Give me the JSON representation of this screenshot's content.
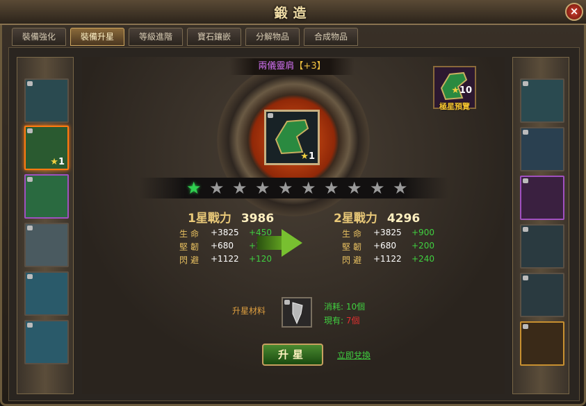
{
  "window": {
    "title": "鍛造",
    "close_label": "×"
  },
  "tabs": [
    {
      "label": "裝備強化",
      "active": false
    },
    {
      "label": "裝備升星",
      "active": true
    },
    {
      "label": "等級進階",
      "active": false
    },
    {
      "label": "寶石鑲嵌",
      "active": false
    },
    {
      "label": "分解物品",
      "active": false
    },
    {
      "label": "合成物品",
      "active": false
    }
  ],
  "left_slots": [
    {
      "name": "hood",
      "color": "#2a4a50"
    },
    {
      "name": "shoulder",
      "color": "#2a5a30",
      "stars": "1",
      "selected": true
    },
    {
      "name": "armor",
      "color": "#2a6a40"
    },
    {
      "name": "belt",
      "color": "#4a5a60"
    },
    {
      "name": "pants",
      "color": "#2a5a6a"
    },
    {
      "name": "boots",
      "color": "#2a5a6a"
    }
  ],
  "right_slots": [
    {
      "name": "bracer",
      "color": "#2a4a50"
    },
    {
      "name": "glove",
      "color": "#2a4050"
    },
    {
      "name": "amulet",
      "color": "#3a2040"
    },
    {
      "name": "ring",
      "color": "#2a3a40"
    },
    {
      "name": "necklace",
      "color": "#2a3a40"
    },
    {
      "name": "weapon",
      "color": "#3a2a18"
    }
  ],
  "item": {
    "name": "兩儀靈肩",
    "plus": "【+3】",
    "stars": "1"
  },
  "preview": {
    "stars": "10",
    "label": "極星預覽"
  },
  "star_rating": {
    "current": 1,
    "max": 10
  },
  "current": {
    "title": "1星戰力",
    "power": "3986",
    "stats": [
      {
        "key": "生命",
        "base": "+3825",
        "add": "+450"
      },
      {
        "key": "堅韌",
        "base": "+680",
        "add": "+100"
      },
      {
        "key": "閃避",
        "base": "+1122",
        "add": "+120"
      }
    ]
  },
  "next": {
    "title": "2星戰力",
    "power": "4296",
    "stats": [
      {
        "key": "生命",
        "base": "+3825",
        "add": "+900"
      },
      {
        "key": "堅韌",
        "base": "+680",
        "add": "+200"
      },
      {
        "key": "閃避",
        "base": "+1122",
        "add": "+240"
      }
    ]
  },
  "material": {
    "label": "升星材料",
    "consume_label": "消耗:",
    "consume_value": "10個",
    "owned_label": "現有:",
    "owned_value": "7個"
  },
  "actions": {
    "upgrade": "升星",
    "exchange": "立即兌換"
  }
}
